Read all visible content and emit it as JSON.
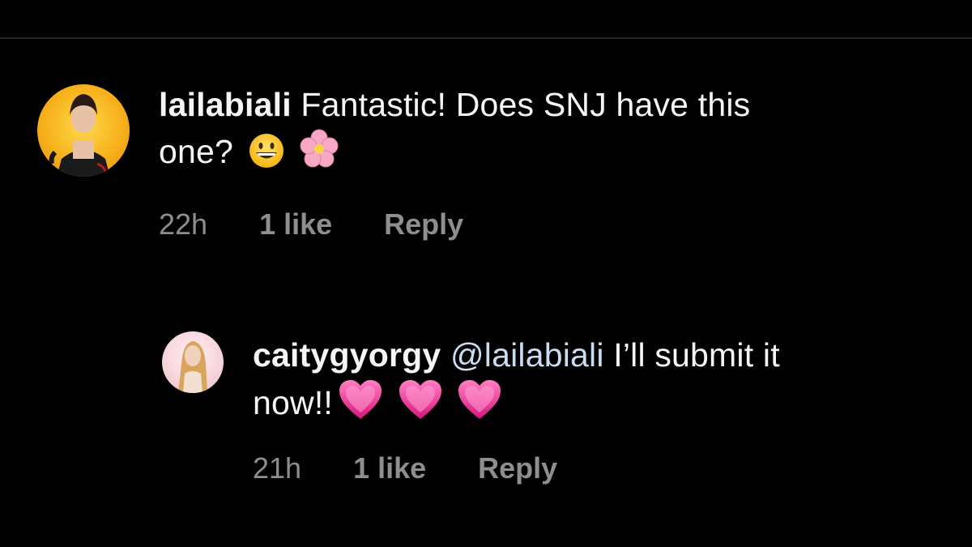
{
  "comments": [
    {
      "username": "lailabiali",
      "text_line1": "Fantastic! Does SNJ have this",
      "text_line2": "one?",
      "emojis": [
        "grinning-face-emoji",
        "cherry-blossom-emoji"
      ],
      "time": "22h",
      "likes": "1 like",
      "reply_label": "Reply"
    },
    {
      "username": "caitygyorgy",
      "mention": "@lailabiali",
      "text_line1": "I’ll submit it",
      "text_line2": "now!!",
      "emojis": [
        "pink-heart-emoji",
        "pink-heart-emoji",
        "pink-heart-emoji"
      ],
      "time": "21h",
      "likes": "1 like",
      "reply_label": "Reply"
    }
  ],
  "colors": {
    "background": "#000000",
    "text": "#f5f5f5",
    "meta": "#8e8e8e",
    "mention": "#c9dcf2",
    "divider": "#262626"
  }
}
